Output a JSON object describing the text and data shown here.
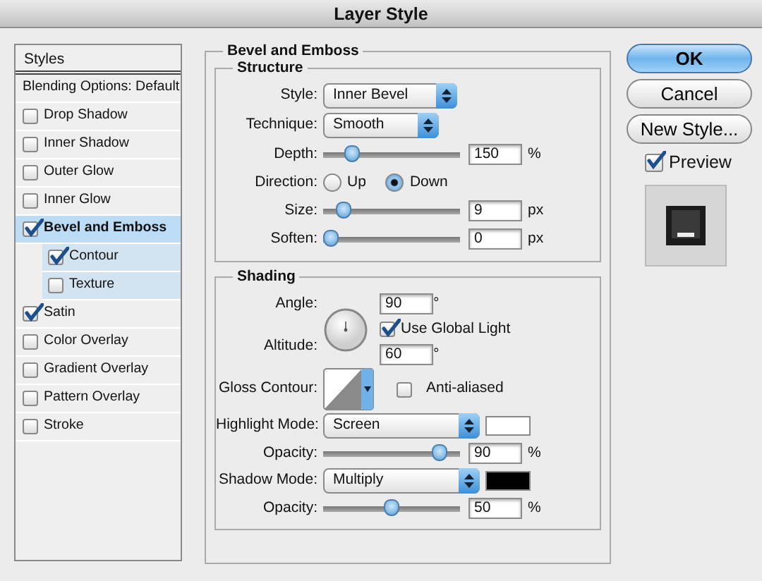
{
  "window": {
    "title": "Layer Style"
  },
  "styles_list": {
    "header": "Styles",
    "items": [
      {
        "kind": "plain",
        "label": "Blending Options: Default",
        "selected": false
      },
      {
        "kind": "check",
        "label": "Drop Shadow",
        "checked": false,
        "selected": false
      },
      {
        "kind": "check",
        "label": "Inner Shadow",
        "checked": false,
        "selected": false
      },
      {
        "kind": "check",
        "label": "Outer Glow",
        "checked": false,
        "selected": false
      },
      {
        "kind": "check",
        "label": "Inner Glow",
        "checked": false,
        "selected": false
      },
      {
        "kind": "check",
        "label": "Bevel and Emboss",
        "checked": true,
        "selected": true,
        "children": [
          {
            "label": "Contour",
            "checked": true
          },
          {
            "label": "Texture",
            "checked": false
          }
        ]
      },
      {
        "kind": "check",
        "label": "Satin",
        "checked": true,
        "selected": false
      },
      {
        "kind": "check",
        "label": "Color Overlay",
        "checked": false,
        "selected": false
      },
      {
        "kind": "check",
        "label": "Gradient Overlay",
        "checked": false,
        "selected": false
      },
      {
        "kind": "check",
        "label": "Pattern Overlay",
        "checked": false,
        "selected": false
      },
      {
        "kind": "check",
        "label": "Stroke",
        "checked": false,
        "selected": false
      }
    ]
  },
  "panel": {
    "title": "Bevel and Emboss",
    "groups": [
      {
        "title": "Structure",
        "rows": [
          {
            "kind": "select",
            "label": "Style:",
            "value": "Inner Bevel"
          },
          {
            "kind": "select",
            "label": "Technique:",
            "value": "Smooth"
          },
          {
            "kind": "slider",
            "label": "Depth:",
            "level": 0.17,
            "value": "150",
            "unit": "%"
          },
          {
            "kind": "radio",
            "label": "Direction:",
            "options": [
              {
                "label": "Up",
                "selected": false
              },
              {
                "label": "Down",
                "selected": true
              }
            ]
          },
          {
            "kind": "slider",
            "label": "Size:",
            "level": 0.1,
            "value": "9",
            "unit": "px"
          },
          {
            "kind": "slider",
            "label": "Soften:",
            "level": 0,
            "value": "0",
            "unit": "px"
          }
        ]
      },
      {
        "title": "Shading",
        "rows": [
          {
            "kind": "angle",
            "label": "Angle:",
            "value": "90",
            "unit": "°",
            "global_light": {
              "label": "Use Global Light",
              "checked": true
            },
            "altitude_label": "Altitude:",
            "altitude": "60",
            "altitude_unit": "°"
          },
          {
            "kind": "contour",
            "label": "Gloss Contour:",
            "anti_aliased": {
              "label": "Anti-aliased",
              "checked": false
            }
          },
          {
            "kind": "select",
            "label": "Highlight Mode:",
            "value": "Screen",
            "color": "#ffffff"
          },
          {
            "kind": "slider",
            "label": "Opacity:",
            "level": 0.9,
            "value": "90",
            "unit": "%"
          },
          {
            "kind": "select",
            "label": "Shadow Mode:",
            "value": "Multiply",
            "color": "#000000"
          },
          {
            "kind": "slider",
            "label": "Opacity:",
            "level": 0.5,
            "value": "50",
            "unit": "%"
          }
        ]
      }
    ]
  },
  "buttons": [
    {
      "label": "OK",
      "kind": "default"
    },
    {
      "label": "Cancel",
      "kind": "normal"
    },
    {
      "label": "New Style...",
      "kind": "normal"
    }
  ],
  "preview": {
    "label": "Preview",
    "checked": true
  }
}
